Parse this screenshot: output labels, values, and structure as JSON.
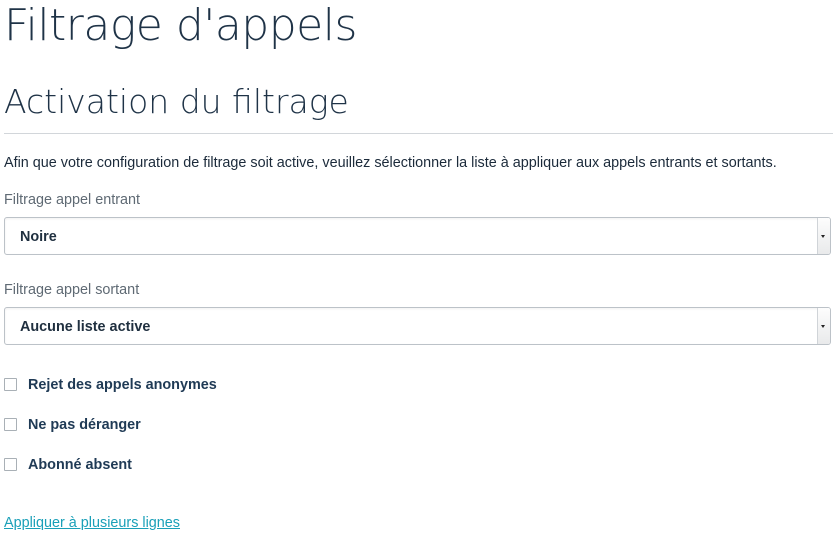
{
  "page": {
    "title": "Filtrage d'appels"
  },
  "section": {
    "title": "Activation du filtrage",
    "intro": "Afin que votre configuration de filtrage soit active, veuillez sélectionner la liste à appliquer aux appels entrants et sortants."
  },
  "incoming": {
    "label": "Filtrage appel entrant",
    "selected": "Noire"
  },
  "outgoing": {
    "label": "Filtrage appel sortant",
    "selected": "Aucune liste active"
  },
  "options": [
    {
      "label": "Rejet des appels anonymes",
      "checked": false
    },
    {
      "label": "Ne pas déranger",
      "checked": false
    },
    {
      "label": "Abonné absent",
      "checked": false
    }
  ],
  "link": {
    "label": "Appliquer à plusieurs lignes"
  },
  "colors": {
    "text": "#1b2a3a",
    "heading": "#1f3347",
    "label": "#5f6a74",
    "option_text": "#1f3a55",
    "link": "#1aa0b8",
    "border": "#bcc2c8"
  }
}
